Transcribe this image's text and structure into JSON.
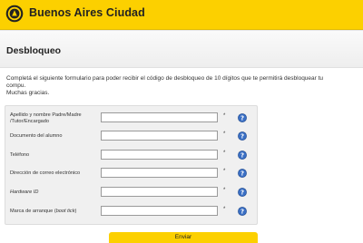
{
  "header": {
    "brand": "Buenos Aires Ciudad"
  },
  "page": {
    "title": "Desbloqueo",
    "intro_line1": "Completá el siguiente formulario para poder recibir el código de desbloqueo de 10 dígitos que te permitirá desbloquear tu",
    "intro_line2": "compu.",
    "intro_line3": "Muchas gracias."
  },
  "form": {
    "fields": [
      {
        "label_line1": "Apellido y nombre Padre/Madre",
        "label_line2": "/Tutor/Encargado",
        "value": "",
        "required": "*"
      },
      {
        "label": "Documento del alumno",
        "value": "",
        "required": "*"
      },
      {
        "label": "Teléfono",
        "value": "",
        "required": "*"
      },
      {
        "label": "Dirección de correo electrónico",
        "value": "",
        "required": "*"
      },
      {
        "label": "Hardware ID",
        "value": "",
        "required": "*"
      },
      {
        "label_text": "Marca de arranque (",
        "label_italic": "boot tick",
        "label_end": ")",
        "value": "",
        "required": "*"
      }
    ],
    "submit_label": "Enviar"
  },
  "colors": {
    "brand_yellow": "#fcd000",
    "help_icon_blue": "#3a6fc4"
  },
  "icons": {
    "logo": "city-seal-icon",
    "help": "question-mark-icon"
  }
}
